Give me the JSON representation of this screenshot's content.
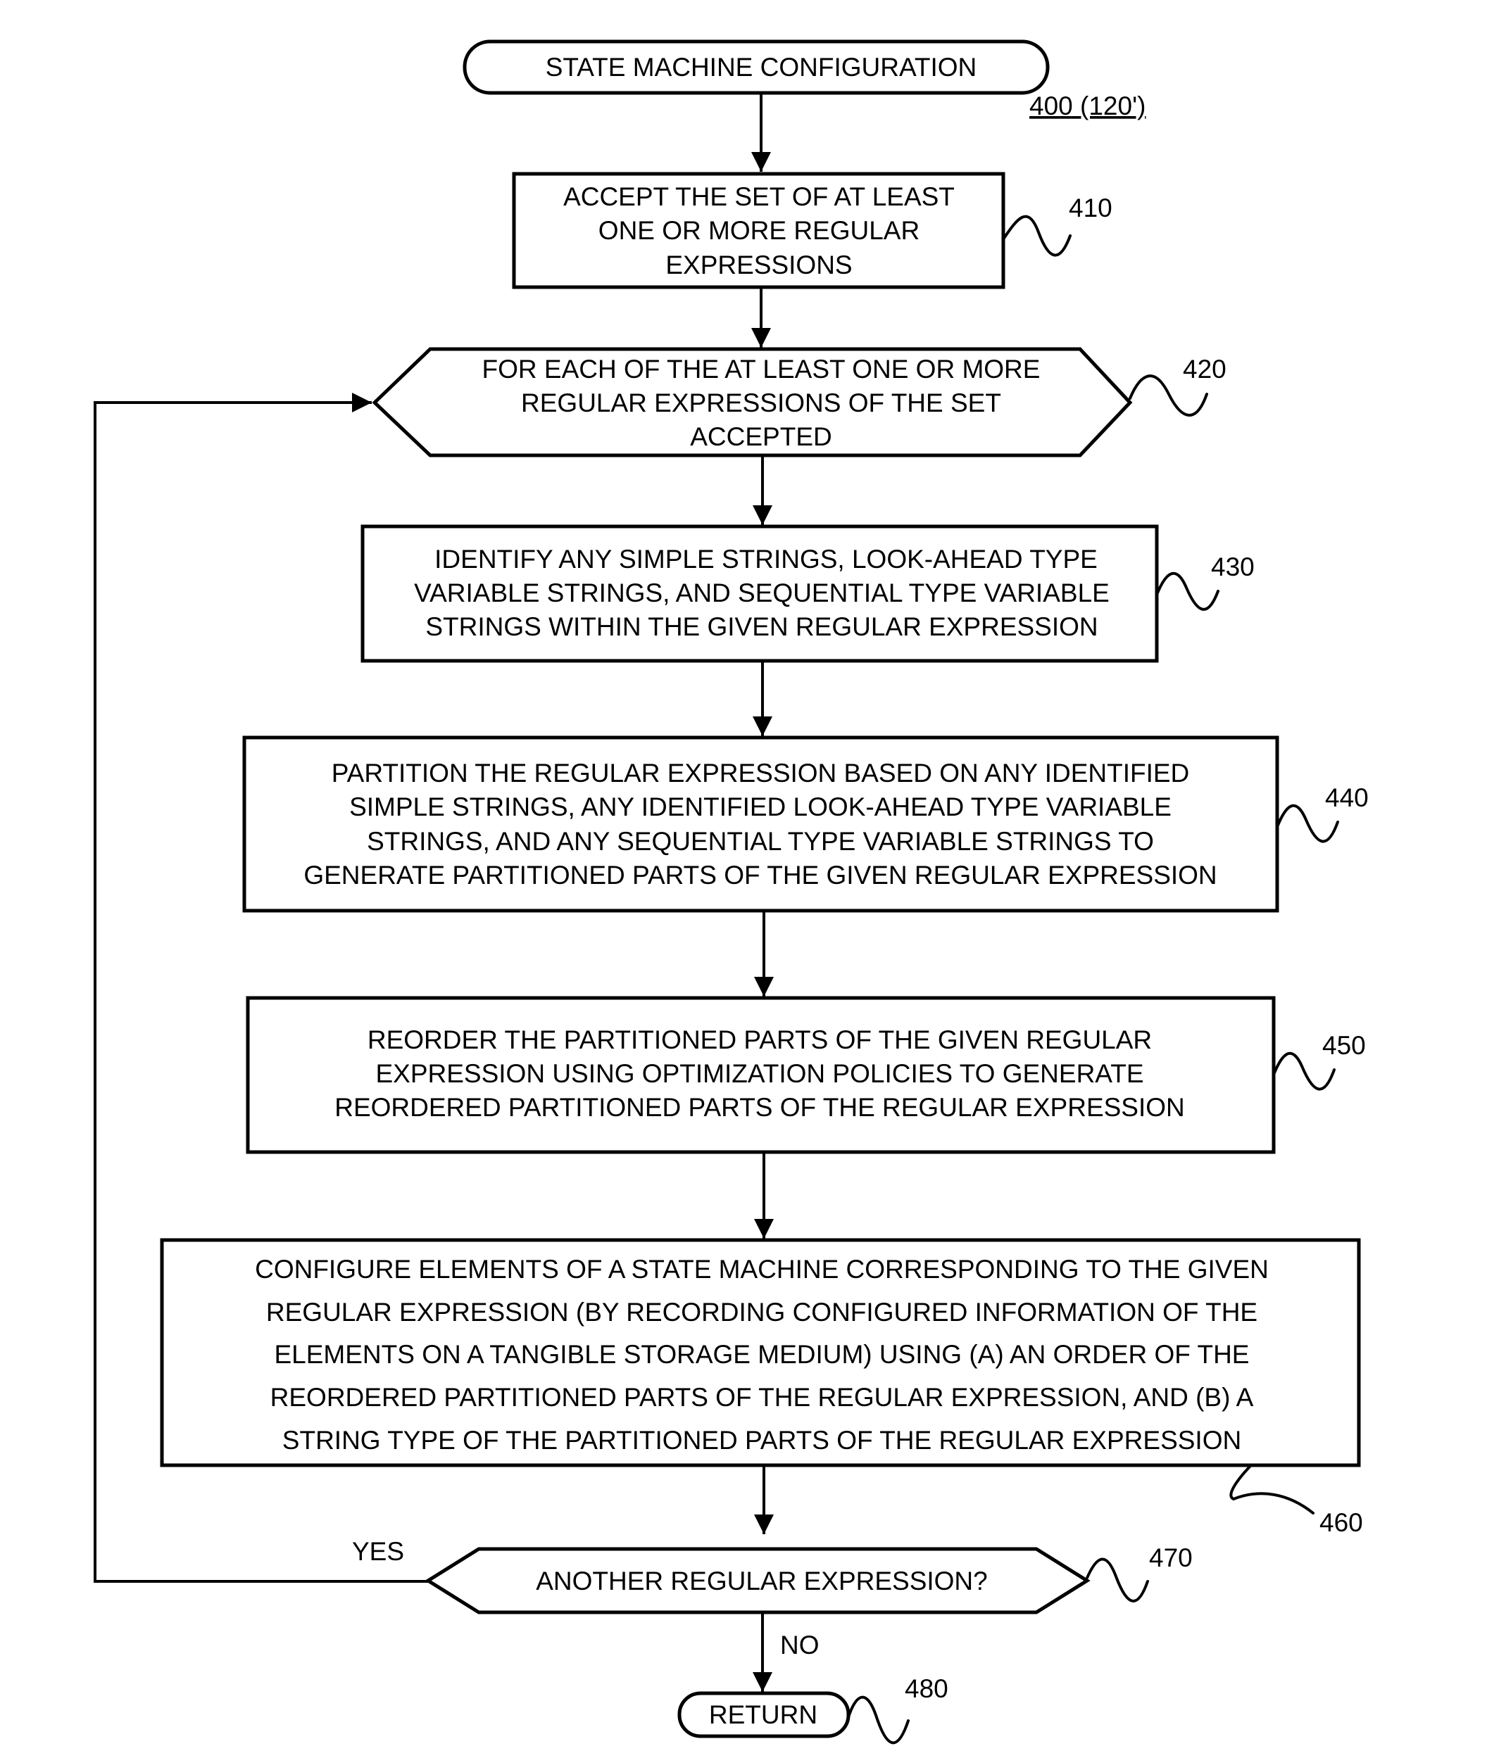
{
  "figure": {
    "reference_label": "400 (120')",
    "nodes": {
      "start": {
        "ref": "",
        "type": "terminal",
        "lines": [
          "STATE MACHINE CONFIGURATION"
        ]
      },
      "n410": {
        "ref": "410",
        "type": "process",
        "lines": [
          "ACCEPT THE SET OF AT LEAST",
          "ONE OR MORE REGULAR",
          "EXPRESSIONS"
        ]
      },
      "n420": {
        "ref": "420",
        "type": "loop",
        "lines": [
          "FOR EACH OF THE AT LEAST ONE OR MORE",
          "REGULAR EXPRESSIONS OF THE SET",
          "ACCEPTED"
        ]
      },
      "n430": {
        "ref": "430",
        "type": "process",
        "lines": [
          "IDENTIFY ANY SIMPLE STRINGS, LOOK-AHEAD TYPE",
          "VARIABLE STRINGS, AND SEQUENTIAL TYPE VARIABLE",
          "STRINGS WITHIN THE GIVEN REGULAR EXPRESSION"
        ]
      },
      "n440": {
        "ref": "440",
        "type": "process",
        "lines": [
          "PARTITION THE REGULAR EXPRESSION BASED ON ANY IDENTIFIED",
          "SIMPLE STRINGS, ANY IDENTIFIED LOOK-AHEAD TYPE VARIABLE",
          "STRINGS, AND ANY SEQUENTIAL TYPE VARIABLE STRINGS TO",
          "GENERATE PARTITIONED PARTS OF THE GIVEN REGULAR EXPRESSION"
        ]
      },
      "n450": {
        "ref": "450",
        "type": "process",
        "lines": [
          "REORDER THE PARTITIONED PARTS OF THE GIVEN REGULAR",
          "EXPRESSION USING OPTIMIZATION POLICIES TO GENERATE",
          "REORDERED PARTITIONED PARTS OF THE REGULAR EXPRESSION"
        ]
      },
      "n460": {
        "ref": "460",
        "type": "process",
        "lines": [
          "CONFIGURE ELEMENTS OF A STATE MACHINE CORRESPONDING TO THE GIVEN",
          "REGULAR EXPRESSION (BY RECORDING CONFIGURED INFORMATION OF THE",
          "ELEMENTS ON A TANGIBLE STORAGE MEDIUM) USING (A) AN ORDER OF THE",
          "REORDERED PARTITIONED PARTS OF THE REGULAR EXPRESSION, AND (B) A",
          "STRING TYPE OF THE PARTITIONED PARTS OF THE REGULAR EXPRESSION"
        ]
      },
      "n470": {
        "ref": "470",
        "type": "decision",
        "lines": [
          "ANOTHER REGULAR EXPRESSION?"
        ]
      },
      "n480": {
        "ref": "480",
        "type": "terminal",
        "lines": [
          "RETURN"
        ]
      }
    },
    "edges": {
      "yes_label": "YES",
      "no_label": "NO"
    }
  }
}
